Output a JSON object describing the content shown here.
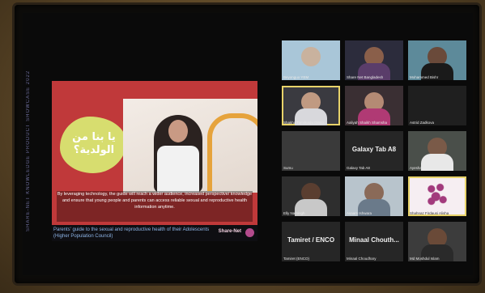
{
  "side_banner": "SHARE-NET KNOWLEDGE PRODUCT SHOWCASE 2022",
  "slide": {
    "arabic_text": "يا بنا من الولدية؟",
    "subtitle": "By leveraging technology, the guide will reach a wider audience, increased perspective/ knowledge and ensure that young people and parents can access reliable sexual and reproductive health information anytime.",
    "caption": "Parents' guide to the sexual and reproductive health of their Adolescents (Higher Population Council)",
    "logo": "Share-Net"
  },
  "participants": [
    {
      "name": "Beyonguo YEM"
    },
    {
      "name": "Share Net Bangladesh"
    },
    {
      "name": "Mohammed Bishr"
    },
    {
      "name": "Shakha Tamilnadu Diaco..."
    },
    {
      "name": "Aaliyah Shaikh Shamsha"
    },
    {
      "name": "Astrid Zadkova"
    },
    {
      "name": "Sumu"
    },
    {
      "name": "Galaxy Tab A8",
      "label": "Galaxy Tab A8"
    },
    {
      "name": "Ayesha Gaoa"
    },
    {
      "name": "Elly Narsingh"
    },
    {
      "name": "Asaam Ishwara"
    },
    {
      "name": "Shahnaz Firdausi Alisha"
    },
    {
      "name": "Tamiret (ENCO)",
      "label": "Tamiret / ENCO"
    },
    {
      "name": "Minaal Choudhary",
      "label": "Minaal Chouth..."
    },
    {
      "name": "Md Moshdul Islam"
    }
  ]
}
